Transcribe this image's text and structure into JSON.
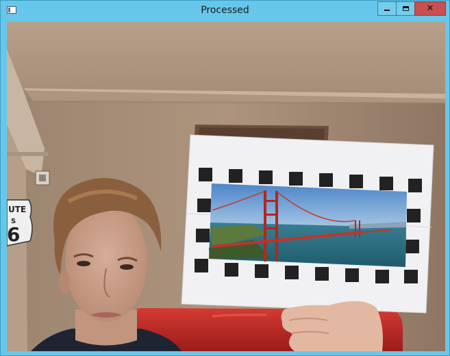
{
  "window": {
    "title": "Processed",
    "minimize_label": "",
    "maximize_label": "",
    "close_label": "✕"
  },
  "sign": {
    "line1": "UTE",
    "line2": "S",
    "line3": "6"
  },
  "colors": {
    "titlebar": "#67c7ea",
    "close_button": "#c75050",
    "wall": "#b49c85",
    "sofa": "#c62824"
  }
}
